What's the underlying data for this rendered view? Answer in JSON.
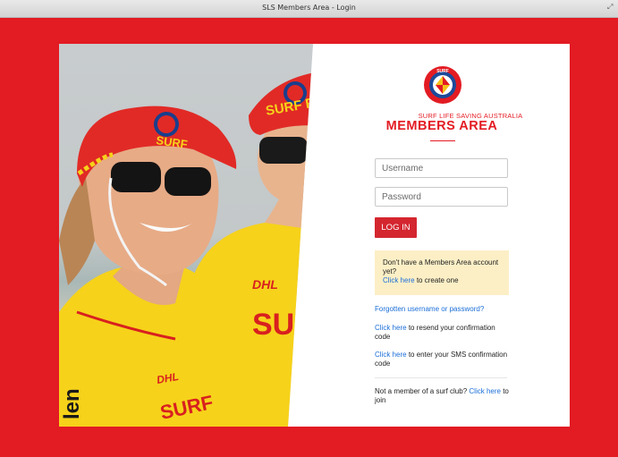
{
  "window": {
    "title": "SLS Members Area - Login"
  },
  "brand": {
    "logo_top": "SURF",
    "logo_bottom": "LIFE SAVING",
    "subtitle": "SURF LIFE SAVING AUSTRALIA",
    "title": "MEMBERS AREA",
    "accent_color": "#e31b23"
  },
  "form": {
    "username": {
      "placeholder": "Username",
      "value": ""
    },
    "password": {
      "placeholder": "Password",
      "value": ""
    },
    "login_label": "LOG IN"
  },
  "notice": {
    "text": "Don't have a Members Area account yet?",
    "link_label": "Click here",
    "link_suffix": "to create one"
  },
  "links": {
    "forgot": "Forgotten username or password?",
    "resend_link": "Click here",
    "resend_text": "to resend your confirmation code",
    "sms_link": "Click here",
    "sms_text": "to enter your SMS confirmation code",
    "join_text": "Not a member of a surf club?",
    "join_link": "Click here",
    "join_suffix": "to join"
  },
  "photo": {
    "description_icon": "surf-lifesavers-photo",
    "cap_text_1": "SURF",
    "cap_text_2": "SURF RESC",
    "shirt_text_1": "DHL",
    "shirt_text_2": "SURF",
    "shirt_text_3": "SURF"
  }
}
